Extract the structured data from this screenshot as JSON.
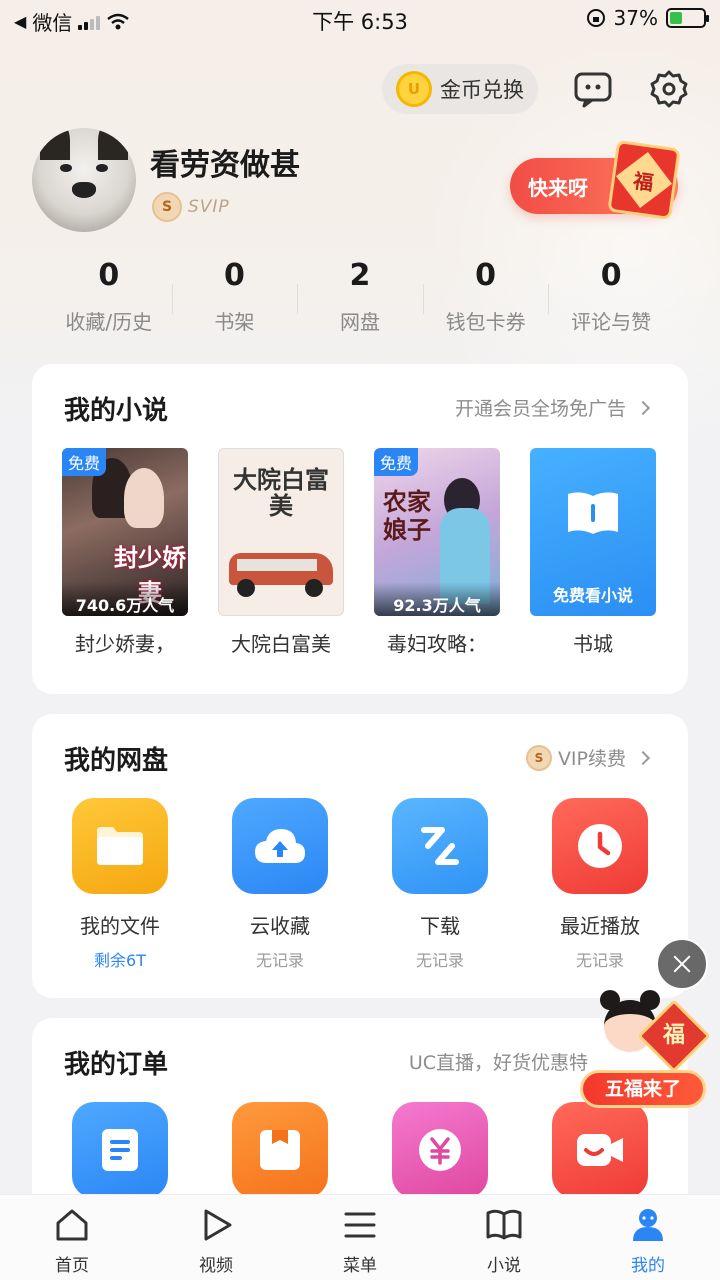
{
  "status_bar": {
    "back_app": "微信",
    "time": "下午 6:53",
    "battery": "37%",
    "battery_level": 0.37
  },
  "header": {
    "coin_exchange": "金币兑换",
    "username": "看劳资做甚",
    "vip_level": "SVIP",
    "promo_button": "快来呀",
    "promo_badge_char": "福"
  },
  "stats": [
    {
      "value": "0",
      "label": "收藏/历史"
    },
    {
      "value": "0",
      "label": "书架"
    },
    {
      "value": "2",
      "label": "网盘"
    },
    {
      "value": "0",
      "label": "钱包卡券"
    },
    {
      "value": "0",
      "label": "评论与赞"
    }
  ],
  "novels": {
    "title": "我的小说",
    "link": "开通会员全场免广告",
    "items": [
      {
        "name": "封少娇妻，",
        "free": "免费",
        "popularity": "740.6万人气",
        "cover_title": "封少娇妻"
      },
      {
        "name": "大院白富美",
        "free": "",
        "popularity": "",
        "cover_title": "大院白富美"
      },
      {
        "name": "毒妇攻略：",
        "free": "免费",
        "popularity": "92.3万人气",
        "cover_title": "农家娘子"
      },
      {
        "name": "书城",
        "free": "",
        "popularity": "",
        "cover_label": "免费看小说"
      }
    ]
  },
  "disk": {
    "title": "我的网盘",
    "link": "VIP续费",
    "items": [
      {
        "name": "我的文件",
        "sub": "剩余6T",
        "icon": "folder-icon",
        "color": "#f9b623"
      },
      {
        "name": "云收藏",
        "sub": "无记录",
        "icon": "cloud-upload-icon",
        "color": "#2b86f5"
      },
      {
        "name": "下载",
        "sub": "无记录",
        "icon": "download-icon",
        "color": "#3aa0fb"
      },
      {
        "name": "最近播放",
        "sub": "无记录",
        "icon": "clock-icon",
        "color": "#f24b44"
      }
    ]
  },
  "orders": {
    "title": "我的订单",
    "link": "UC直播，好货优惠特",
    "icons": [
      {
        "icon": "document-icon",
        "color": "#2b8ef3"
      },
      {
        "icon": "bag-icon",
        "color": "#f97a26"
      },
      {
        "icon": "yuan-icon",
        "color": "#e85ab8"
      },
      {
        "icon": "video-icon",
        "color": "#f24b44"
      }
    ]
  },
  "float_promo": {
    "label": "五福来了",
    "badge_char": "福"
  },
  "nav": [
    {
      "label": "首页",
      "icon": "home-icon"
    },
    {
      "label": "视频",
      "icon": "play-icon"
    },
    {
      "label": "菜单",
      "icon": "menu-icon"
    },
    {
      "label": "小说",
      "icon": "novel-icon"
    },
    {
      "label": "我的",
      "icon": "profile-icon",
      "active": true
    }
  ]
}
